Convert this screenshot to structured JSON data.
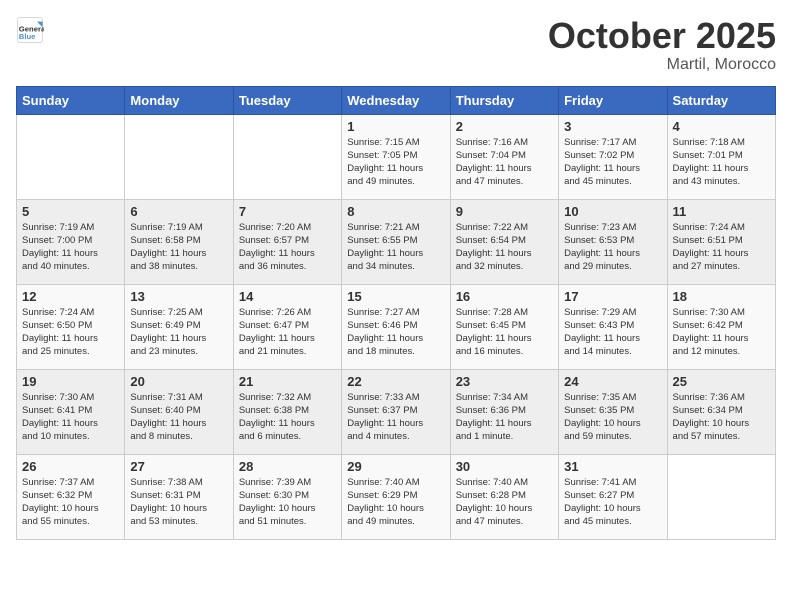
{
  "logo": {
    "general": "General",
    "blue": "Blue"
  },
  "title": {
    "month": "October 2025",
    "location": "Martil, Morocco"
  },
  "days_of_week": [
    "Sunday",
    "Monday",
    "Tuesday",
    "Wednesday",
    "Thursday",
    "Friday",
    "Saturday"
  ],
  "weeks": [
    [
      {
        "num": "",
        "info": ""
      },
      {
        "num": "",
        "info": ""
      },
      {
        "num": "",
        "info": ""
      },
      {
        "num": "1",
        "info": "Sunrise: 7:15 AM\nSunset: 7:05 PM\nDaylight: 11 hours\nand 49 minutes."
      },
      {
        "num": "2",
        "info": "Sunrise: 7:16 AM\nSunset: 7:04 PM\nDaylight: 11 hours\nand 47 minutes."
      },
      {
        "num": "3",
        "info": "Sunrise: 7:17 AM\nSunset: 7:02 PM\nDaylight: 11 hours\nand 45 minutes."
      },
      {
        "num": "4",
        "info": "Sunrise: 7:18 AM\nSunset: 7:01 PM\nDaylight: 11 hours\nand 43 minutes."
      }
    ],
    [
      {
        "num": "5",
        "info": "Sunrise: 7:19 AM\nSunset: 7:00 PM\nDaylight: 11 hours\nand 40 minutes."
      },
      {
        "num": "6",
        "info": "Sunrise: 7:19 AM\nSunset: 6:58 PM\nDaylight: 11 hours\nand 38 minutes."
      },
      {
        "num": "7",
        "info": "Sunrise: 7:20 AM\nSunset: 6:57 PM\nDaylight: 11 hours\nand 36 minutes."
      },
      {
        "num": "8",
        "info": "Sunrise: 7:21 AM\nSunset: 6:55 PM\nDaylight: 11 hours\nand 34 minutes."
      },
      {
        "num": "9",
        "info": "Sunrise: 7:22 AM\nSunset: 6:54 PM\nDaylight: 11 hours\nand 32 minutes."
      },
      {
        "num": "10",
        "info": "Sunrise: 7:23 AM\nSunset: 6:53 PM\nDaylight: 11 hours\nand 29 minutes."
      },
      {
        "num": "11",
        "info": "Sunrise: 7:24 AM\nSunset: 6:51 PM\nDaylight: 11 hours\nand 27 minutes."
      }
    ],
    [
      {
        "num": "12",
        "info": "Sunrise: 7:24 AM\nSunset: 6:50 PM\nDaylight: 11 hours\nand 25 minutes."
      },
      {
        "num": "13",
        "info": "Sunrise: 7:25 AM\nSunset: 6:49 PM\nDaylight: 11 hours\nand 23 minutes."
      },
      {
        "num": "14",
        "info": "Sunrise: 7:26 AM\nSunset: 6:47 PM\nDaylight: 11 hours\nand 21 minutes."
      },
      {
        "num": "15",
        "info": "Sunrise: 7:27 AM\nSunset: 6:46 PM\nDaylight: 11 hours\nand 18 minutes."
      },
      {
        "num": "16",
        "info": "Sunrise: 7:28 AM\nSunset: 6:45 PM\nDaylight: 11 hours\nand 16 minutes."
      },
      {
        "num": "17",
        "info": "Sunrise: 7:29 AM\nSunset: 6:43 PM\nDaylight: 11 hours\nand 14 minutes."
      },
      {
        "num": "18",
        "info": "Sunrise: 7:30 AM\nSunset: 6:42 PM\nDaylight: 11 hours\nand 12 minutes."
      }
    ],
    [
      {
        "num": "19",
        "info": "Sunrise: 7:30 AM\nSunset: 6:41 PM\nDaylight: 11 hours\nand 10 minutes."
      },
      {
        "num": "20",
        "info": "Sunrise: 7:31 AM\nSunset: 6:40 PM\nDaylight: 11 hours\nand 8 minutes."
      },
      {
        "num": "21",
        "info": "Sunrise: 7:32 AM\nSunset: 6:38 PM\nDaylight: 11 hours\nand 6 minutes."
      },
      {
        "num": "22",
        "info": "Sunrise: 7:33 AM\nSunset: 6:37 PM\nDaylight: 11 hours\nand 4 minutes."
      },
      {
        "num": "23",
        "info": "Sunrise: 7:34 AM\nSunset: 6:36 PM\nDaylight: 11 hours\nand 1 minute."
      },
      {
        "num": "24",
        "info": "Sunrise: 7:35 AM\nSunset: 6:35 PM\nDaylight: 10 hours\nand 59 minutes."
      },
      {
        "num": "25",
        "info": "Sunrise: 7:36 AM\nSunset: 6:34 PM\nDaylight: 10 hours\nand 57 minutes."
      }
    ],
    [
      {
        "num": "26",
        "info": "Sunrise: 7:37 AM\nSunset: 6:32 PM\nDaylight: 10 hours\nand 55 minutes."
      },
      {
        "num": "27",
        "info": "Sunrise: 7:38 AM\nSunset: 6:31 PM\nDaylight: 10 hours\nand 53 minutes."
      },
      {
        "num": "28",
        "info": "Sunrise: 7:39 AM\nSunset: 6:30 PM\nDaylight: 10 hours\nand 51 minutes."
      },
      {
        "num": "29",
        "info": "Sunrise: 7:40 AM\nSunset: 6:29 PM\nDaylight: 10 hours\nand 49 minutes."
      },
      {
        "num": "30",
        "info": "Sunrise: 7:40 AM\nSunset: 6:28 PM\nDaylight: 10 hours\nand 47 minutes."
      },
      {
        "num": "31",
        "info": "Sunrise: 7:41 AM\nSunset: 6:27 PM\nDaylight: 10 hours\nand 45 minutes."
      },
      {
        "num": "",
        "info": ""
      }
    ]
  ]
}
